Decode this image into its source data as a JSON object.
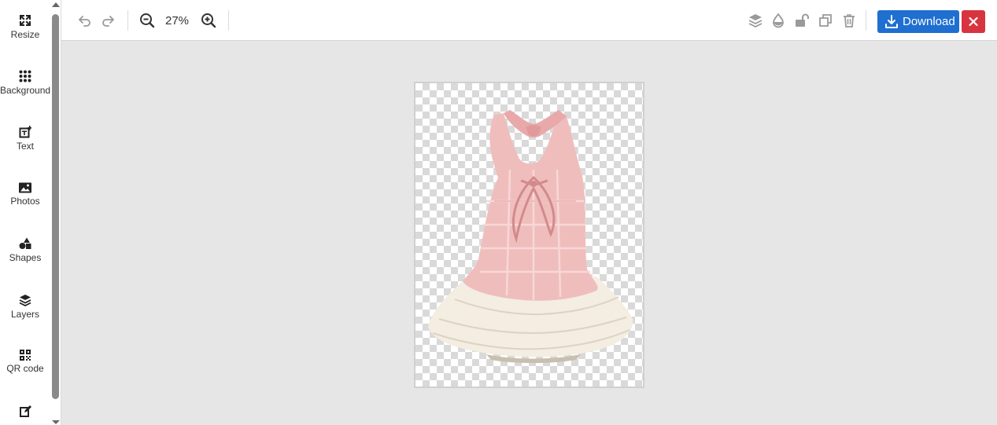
{
  "sidebar": {
    "items": [
      {
        "label": "Resize",
        "icon": "expand-arrows-icon"
      },
      {
        "label": "Background",
        "icon": "dots-grid-icon"
      },
      {
        "label": "Text",
        "icon": "text-add-icon"
      },
      {
        "label": "Photos",
        "icon": "image-icon"
      },
      {
        "label": "Shapes",
        "icon": "shapes-icon"
      },
      {
        "label": "Layers",
        "icon": "layers-icon"
      },
      {
        "label": "QR code",
        "icon": "qr-code-icon"
      },
      {
        "label": "",
        "icon": "edit-icon"
      }
    ]
  },
  "toolbar": {
    "zoom_level": "27%",
    "download_label": "Download",
    "close_label": "✕"
  },
  "canvas": {
    "image_subject": "pink plaid halter top with white ruffled tiered skirt on transparent background"
  },
  "colors": {
    "download": "#1f6fd1",
    "close": "#d8343f"
  }
}
